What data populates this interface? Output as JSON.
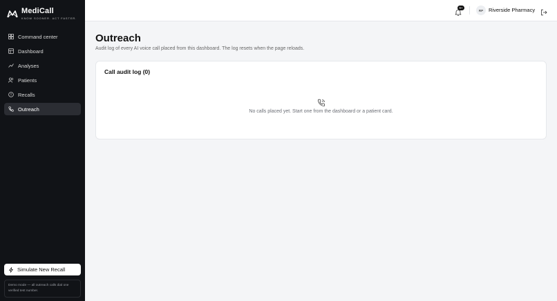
{
  "brand": {
    "name": "MediCall",
    "tagline": "KNOW SOONER. ACT FASTER."
  },
  "sidebar": {
    "items": [
      {
        "label": "Command center",
        "icon": "grid-icon"
      },
      {
        "label": "Dashboard",
        "icon": "dashboard-icon"
      },
      {
        "label": "Analyses",
        "icon": "chart-icon"
      },
      {
        "label": "Patients",
        "icon": "users-icon"
      },
      {
        "label": "Recalls",
        "icon": "alert-circle-icon"
      },
      {
        "label": "Outreach",
        "icon": "phone-icon",
        "active": true
      }
    ],
    "simulate_button": "Simulate New Recall",
    "demo_note": "Demo mode — all outreach calls dial one verified test number."
  },
  "topbar": {
    "notification_badge": "9+",
    "avatar_initials": "RP",
    "org_name": "Riverside Pharmacy"
  },
  "main": {
    "title": "Outreach",
    "subtitle": "Audit log of every AI voice call placed from this dashboard. The log resets when the page reloads.",
    "card": {
      "title": "Call audit log (0)",
      "empty_message": "No calls placed yet. Start one from the dashboard or a patient card."
    }
  },
  "colors": {
    "sidebar_bg": "#111317",
    "active_item_bg": "#2b2d33",
    "page_bg": "#f4f5f7"
  }
}
